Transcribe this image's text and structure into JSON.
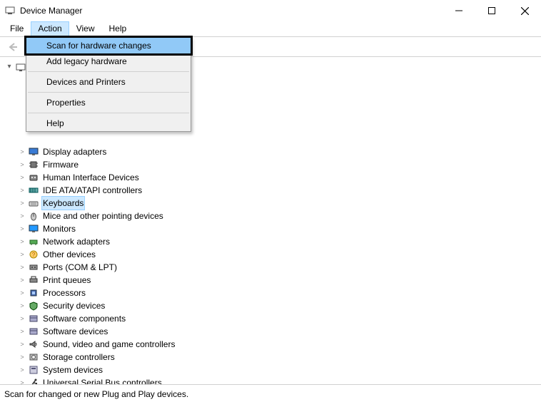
{
  "window": {
    "title": "Device Manager"
  },
  "menubar": {
    "items": [
      "File",
      "Action",
      "View",
      "Help"
    ],
    "active_index": 1
  },
  "dropdown": {
    "items": [
      {
        "label": "Scan for hardware changes",
        "highlight": true
      },
      {
        "label": "Add legacy hardware"
      },
      {
        "sep": true
      },
      {
        "label": "Devices and Printers"
      },
      {
        "sep": true
      },
      {
        "label": "Properties"
      },
      {
        "sep": true
      },
      {
        "label": "Help"
      }
    ]
  },
  "tree": {
    "root_label": "",
    "selected_label": "Keyboards",
    "children": [
      {
        "label": "Display adapters",
        "icon": "display"
      },
      {
        "label": "Firmware",
        "icon": "chip"
      },
      {
        "label": "Human Interface Devices",
        "icon": "hid"
      },
      {
        "label": "IDE ATA/ATAPI controllers",
        "icon": "ide"
      },
      {
        "label": "Keyboards",
        "icon": "keyboard"
      },
      {
        "label": "Mice and other pointing devices",
        "icon": "mouse"
      },
      {
        "label": "Monitors",
        "icon": "monitor"
      },
      {
        "label": "Network adapters",
        "icon": "network"
      },
      {
        "label": "Other devices",
        "icon": "other"
      },
      {
        "label": "Ports (COM & LPT)",
        "icon": "port"
      },
      {
        "label": "Print queues",
        "icon": "printer"
      },
      {
        "label": "Processors",
        "icon": "cpu"
      },
      {
        "label": "Security devices",
        "icon": "security"
      },
      {
        "label": "Software components",
        "icon": "software"
      },
      {
        "label": "Software devices",
        "icon": "software"
      },
      {
        "label": "Sound, video and game controllers",
        "icon": "sound"
      },
      {
        "label": "Storage controllers",
        "icon": "storage"
      },
      {
        "label": "System devices",
        "icon": "system"
      },
      {
        "label": "Universal Serial Bus controllers",
        "icon": "usb"
      }
    ]
  },
  "statusbar": {
    "text": "Scan for changed or new Plug and Play devices."
  }
}
